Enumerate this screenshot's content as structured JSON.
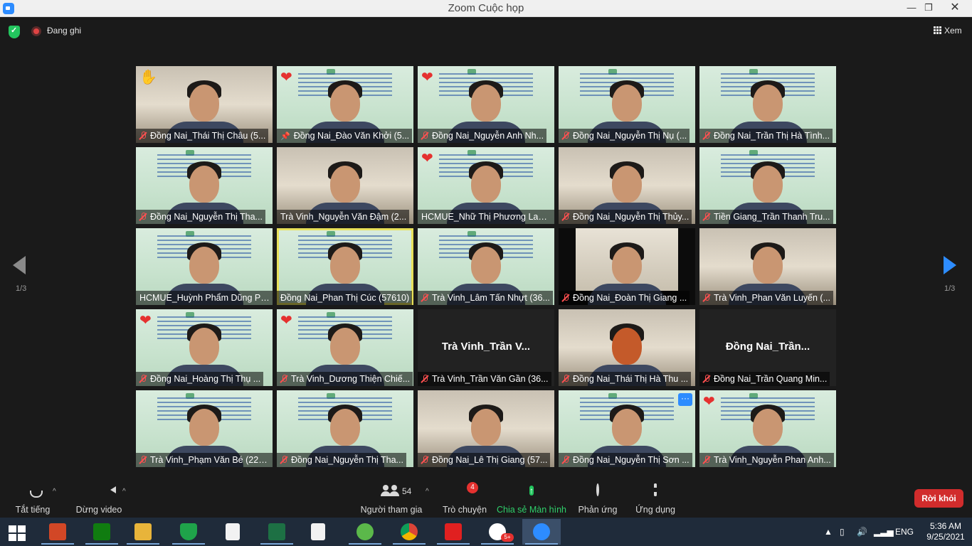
{
  "window": {
    "title": "Zoom Cuộc họp",
    "minimize": "—",
    "maximize": "❐",
    "close": "✕"
  },
  "topbar": {
    "recording": "Đang ghi",
    "view": "Xem"
  },
  "gallery": {
    "page_left": "1/3",
    "page_right": "1/3",
    "tiles": [
      {
        "name": "Đồng Nai_Thái Thị Châu (5...",
        "reaction": "✋"
      },
      {
        "name": "Đồng Nai_Đào Văn Khởi (5...",
        "reaction": "❤"
      },
      {
        "name": "Đồng Nai_Nguyễn Anh Nh...",
        "reaction": "❤"
      },
      {
        "name": "Đồng Nai_Nguyễn Thị Nụ (..."
      },
      {
        "name": "Đồng Nai_Trần Thị Hà Tình..."
      },
      {
        "name": "Đồng Nai_Nguyễn Thị Tha..."
      },
      {
        "name": "Trà Vinh_Nguyễn Văn Đậm (2..."
      },
      {
        "name": "HCMUE_Nhữ Thị Phương Lan ...",
        "reaction": "❤"
      },
      {
        "name": "Đồng Nai_Nguyễn Thị Thủy..."
      },
      {
        "name": "Tiền Giang_Trần Thanh Tru..."
      },
      {
        "name": "HCMUE_Huỳnh Phẩm Dũng Ph..."
      },
      {
        "name": "Đồng Nai_Phan Thị Cúc (57610)"
      },
      {
        "name": "Trà Vinh_Lâm Tấn Nhựt (36..."
      },
      {
        "name": "Đồng Nai_Đoàn Thị Giang ..."
      },
      {
        "name": "Trà Vinh_Phan Văn Luyến (..."
      },
      {
        "name": "Đồng Nai_Hoàng Thị Thụ ...",
        "reaction": "❤"
      },
      {
        "name": "Trà Vinh_Dương Thiện Chiế...",
        "reaction": "❤"
      },
      {
        "name": "Trà Vinh_Trần Văn Gần (36...",
        "big_name": "Trà Vinh_Trần V..."
      },
      {
        "name": "Đồng Nai_Thái Thị Hà Thu ..."
      },
      {
        "name": "Đồng Nai_Trần Quang Min...",
        "big_name": "Đồng  Nai_Trần..."
      },
      {
        "name": "Trà Vinh_Phạm Văn Bé (221..."
      },
      {
        "name": "Đồng Nai_Nguyễn Thị Tha..."
      },
      {
        "name": "Đồng Nai_Lê Thị Giang (57..."
      },
      {
        "name": "Đồng Nai_Nguyễn Thị Sơn ...",
        "more": "···"
      },
      {
        "name": "Trà Vinh_Nguyễn Phan Anh...",
        "reaction": "❤"
      }
    ]
  },
  "toolbar": {
    "mute": "Tắt tiếng",
    "stop_video": "Dừng video",
    "participants": "Người tham gia",
    "participants_count": "54",
    "chat": "Trò chuyện",
    "chat_badge": "4",
    "share": "Chia sẻ Màn hình",
    "reactions": "Phản ứng",
    "apps": "Ứng dụng",
    "leave": "Rời khỏi"
  },
  "taskbar": {
    "time": "5:36 AM",
    "date": "9/25/2021",
    "lang": "ENG",
    "zalo_badge": "5+",
    "apps": [
      "windows-start",
      "powerpoint",
      "store",
      "file-explorer",
      "shield-app",
      "document",
      "excel",
      "document-2",
      "coccoc-browser",
      "chrome",
      "pdf-reader",
      "zalo",
      "zoom"
    ]
  },
  "colors": {
    "accent_blue": "#2d8cff",
    "share_green": "#23c55e",
    "leave_red": "#d12c2c",
    "heart_red": "#e5312f",
    "active_speaker": "#e8e15a"
  }
}
